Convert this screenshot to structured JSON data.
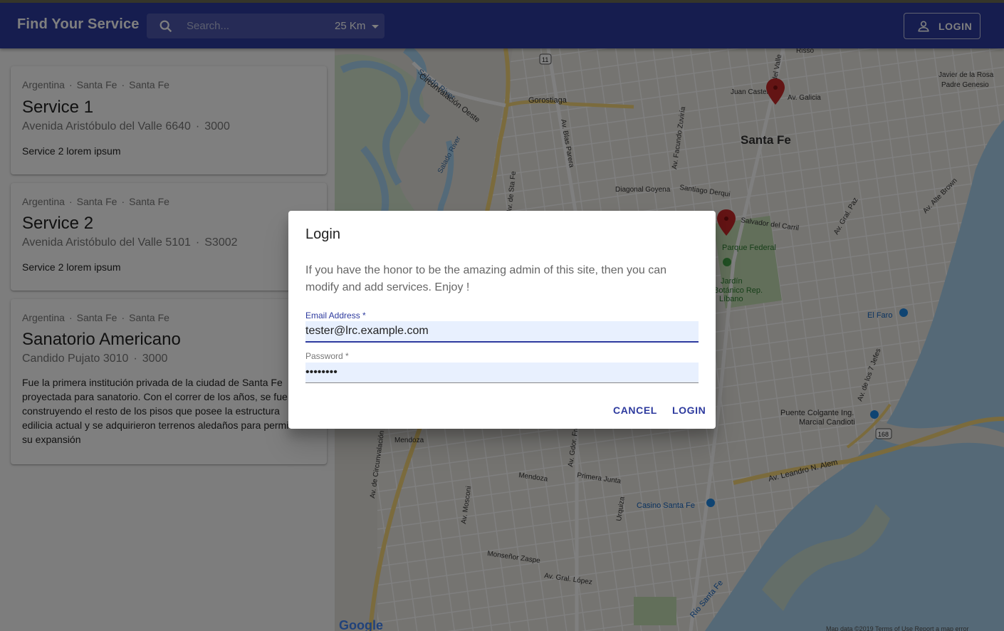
{
  "header": {
    "title": "Find Your Service",
    "search_placeholder": "Search...",
    "radius": "25 Km",
    "login_label": "LOGIN"
  },
  "services": [
    {
      "breadcrumb": [
        "Argentina",
        "Santa Fe",
        "Santa Fe"
      ],
      "title": "Service 1",
      "address": "Avenida Aristóbulo del Valle 6640",
      "zip": "3000",
      "description": "Service 2 lorem ipsum"
    },
    {
      "breadcrumb": [
        "Argentina",
        "Santa Fe",
        "Santa Fe"
      ],
      "title": "Service 2",
      "address": "Avenida Aristóbulo del Valle 5101",
      "zip": "S3002",
      "description": "Service 2 lorem ipsum"
    },
    {
      "breadcrumb": [
        "Argentina",
        "Santa Fe",
        "Santa Fe"
      ],
      "title": "Sanatorio Americano",
      "address": "Candido Pujato 3010",
      "zip": "3000",
      "description": "Fue la primera institución privada de la ciudad de Santa Fe proyectada para sanatorio. Con el correr de los años, se fue construyendo el resto de los pisos que posee la estructura edilicia actual y se adquirieron terrenos aledaños para permitir su expansión"
    }
  ],
  "map": {
    "city_label": "Santa Fe",
    "labels": {
      "gorostiaga": "Gorostiaga",
      "salado_river": "Salado River",
      "circunvalacion": "Circunvalación Oeste",
      "salado_river2": "Salado River",
      "av_de_sta_fe": "Av. de Sta Fe",
      "av_blas_parera": "Av. Blas Parera",
      "av_facundo_zuviria": "Av. Facundo Zuviría",
      "juan_castelli": "Juan Castelli",
      "av_galicia": "Av. Galicia",
      "javier_rosa": "Javier de la Rosa",
      "padre_genesio": "Padre Genesio",
      "diagonal_goyena": "Diagonal Goyena",
      "santiago_derqui": "Santiago Derqui",
      "salvador_carril": "Salvador del Carril",
      "parque_federal": "Parque Federal",
      "jardin": "Jardín",
      "botanico": "Botánico Rep.",
      "libano": "Líbano",
      "el_faro": "El Faro",
      "av_alte_brown": "Av. Alte Brown",
      "av_gral_paz": "Av. Gral. Paz",
      "puente": "Puente Colgante Ing.",
      "marcial": "Marcial Candioti",
      "av_leandro_alem": "Av. Leandro N. Alem",
      "casino": "Casino Santa Fe",
      "mendoza": "Mendoza",
      "primera_junta": "Primera Junta",
      "monsenor_zaspe": "Monseñor Zaspe",
      "av_gral_lopez": "Av. Gral. López",
      "rio_santa_fe": "Río Santa Fe",
      "av_mosconi": "Av. Mosconi",
      "av_gdor_freyre": "Av. Gdor. Freyre",
      "urquiza": "Urquiza",
      "av_de_los_7_jefes": "Av. de los 7 Jefes",
      "av_circunvalacion": "Av. de Circunvalación",
      "route_11": "11",
      "route_168": "168",
      "risso": "Risso",
      "av_del_valle": "Av. del Valle",
      "google": "Google",
      "footer": "Map data ©2019   Terms of Use   Report a map error"
    }
  },
  "dialog": {
    "title": "Login",
    "text": "If you have the honor to be the amazing admin of this site, then you can modify and add services. Enjoy !",
    "email_label": "Email Address *",
    "email_value": "tester@lrc.example.com",
    "password_label": "Password *",
    "password_value": "••••••••",
    "cancel_label": "CANCEL",
    "login_label": "LOGIN"
  },
  "colors": {
    "primary": "#2d3a9e",
    "marker": "#c62828",
    "water": "#aadaff",
    "park": "#c8e6c9"
  }
}
